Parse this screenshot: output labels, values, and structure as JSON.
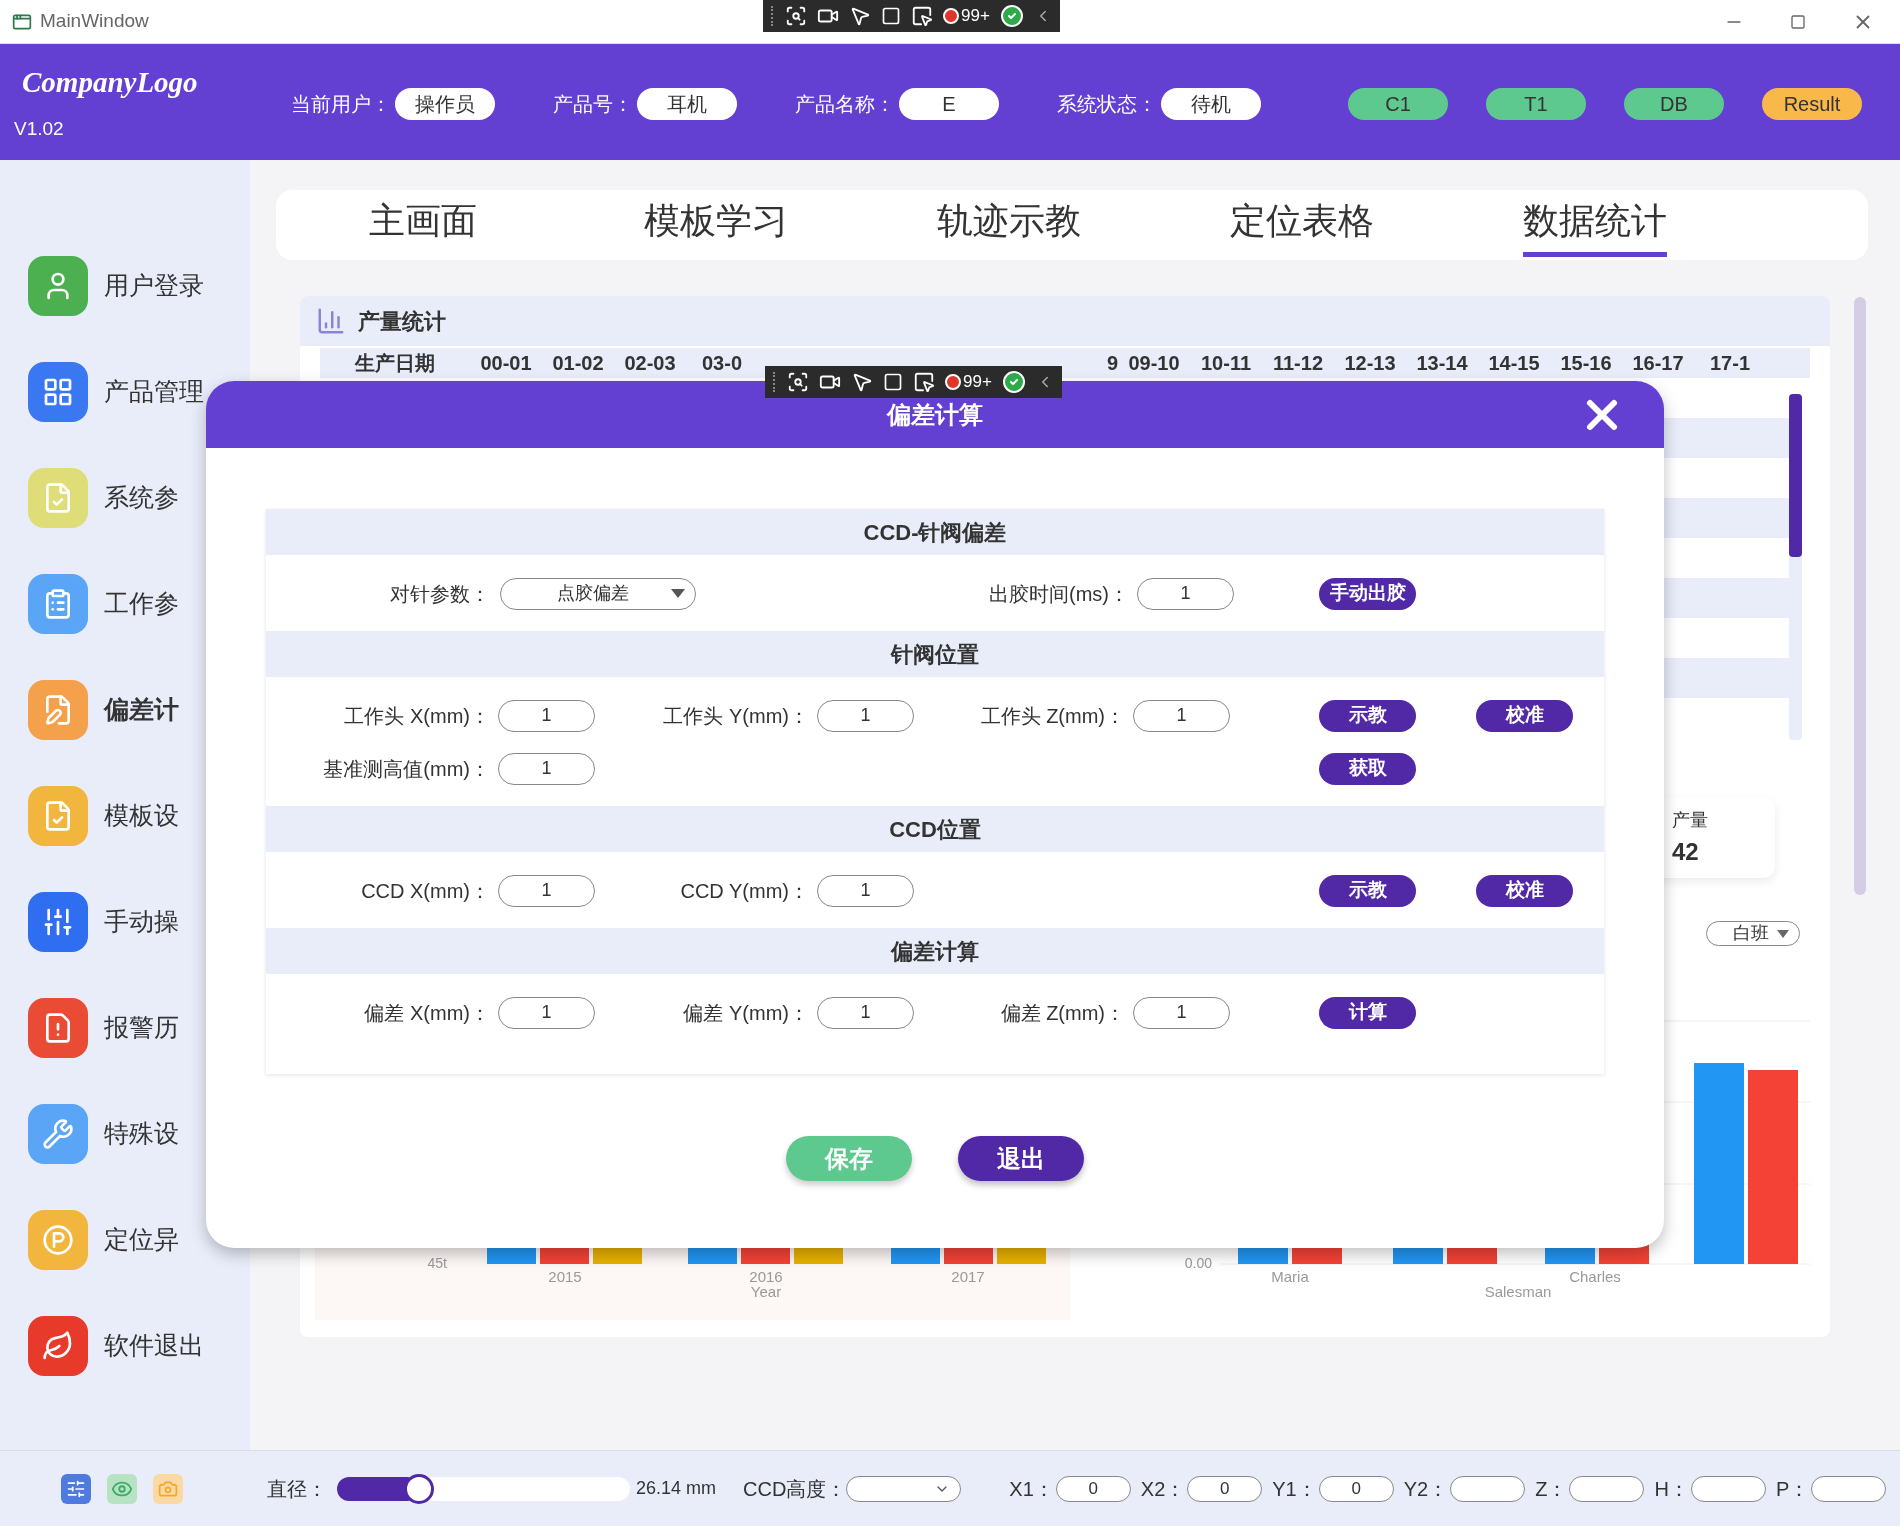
{
  "window": {
    "title": "MainWindow"
  },
  "recorder_toolbars": [
    {
      "badge": "99+"
    },
    {
      "badge": "99+"
    }
  ],
  "header": {
    "logo": "CompanyLogo",
    "version": "V1.02",
    "fields": [
      {
        "label": "当前用户：",
        "value": "操作员"
      },
      {
        "label": "产品号：",
        "value": "耳机"
      },
      {
        "label": "产品名称：",
        "value": "E"
      },
      {
        "label": "系统状态：",
        "value": "待机"
      }
    ],
    "indicators": [
      {
        "label": "C1",
        "color": "#5ec98f"
      },
      {
        "label": "T1",
        "color": "#5ec98f"
      },
      {
        "label": "DB",
        "color": "#5ec98f"
      },
      {
        "label": "Result",
        "color": "#f9b94a"
      }
    ]
  },
  "sidebar": {
    "items": [
      {
        "label": "用户登录",
        "color": "#4cb050",
        "selected": false
      },
      {
        "label": "产品管理",
        "color": "#3a78f2",
        "selected": false
      },
      {
        "label": "系统参",
        "color": "#dedd78",
        "selected": false
      },
      {
        "label": "工作参",
        "color": "#5aa5f5",
        "selected": false
      },
      {
        "label": "偏差计",
        "color": "#f5a04a",
        "selected": true
      },
      {
        "label": "模板设",
        "color": "#f2b53e",
        "selected": false
      },
      {
        "label": "手动操",
        "color": "#2f6ef0",
        "selected": false
      },
      {
        "label": "报警历",
        "color": "#e94b35",
        "selected": false
      },
      {
        "label": "特殊设",
        "color": "#5aa5f5",
        "selected": false
      },
      {
        "label": "定位异",
        "color": "#f2b53e",
        "selected": false
      },
      {
        "label": "软件退出",
        "color": "#e83a2a",
        "selected": false
      }
    ]
  },
  "tabs": [
    {
      "label": "主画面",
      "selected": false
    },
    {
      "label": "模板学习",
      "selected": false
    },
    {
      "label": "轨迹示教",
      "selected": false
    },
    {
      "label": "定位表格",
      "selected": false
    },
    {
      "label": "数据统计",
      "selected": true
    }
  ],
  "stats_panel": {
    "title": "产量统计",
    "table": {
      "columns": [
        "生产日期",
        "00-01",
        "01-02",
        "02-03",
        "03-0",
        "9",
        "09-10",
        "10-11",
        "11-12",
        "12-13",
        "13-14",
        "14-15",
        "15-16",
        "16-17",
        "17-1"
      ]
    },
    "total_card": {
      "label": "产量",
      "value": "42"
    },
    "shift_select": {
      "value": "白班"
    },
    "year_chart": {
      "ytick": "45t",
      "categories": [
        "2015",
        "2016",
        "2017"
      ],
      "xlabel": "Year"
    },
    "salesman_chart": {
      "ytick": "0.00",
      "categories": [
        "Maria",
        "Charles"
      ],
      "xlabel": "Salesman"
    }
  },
  "dialog": {
    "title": "偏差计算",
    "sections": [
      {
        "title": "CCD-针阀偏差",
        "rows": [
          {
            "fields": [
              {
                "kind": "select",
                "label": "对针参数：",
                "value": "点胶偏差"
              },
              {
                "kind": "field",
                "label": "出胶时间(ms)：",
                "value": "1"
              }
            ],
            "buttons": [
              "手动出胶"
            ]
          }
        ]
      },
      {
        "title": "针阀位置",
        "rows": [
          {
            "fields": [
              {
                "kind": "field",
                "label": "工作头 X(mm)：",
                "value": "1"
              },
              {
                "kind": "field",
                "label": "工作头 Y(mm)：",
                "value": "1"
              },
              {
                "kind": "field",
                "label": "工作头 Z(mm)：",
                "value": "1"
              }
            ],
            "buttons": [
              "示教",
              "校准"
            ]
          },
          {
            "fields": [
              {
                "kind": "field",
                "label": "基准测高值(mm)：",
                "value": "1"
              }
            ],
            "buttons": [
              "获取"
            ]
          }
        ]
      },
      {
        "title": "CCD位置",
        "rows": [
          {
            "fields": [
              {
                "kind": "field",
                "label": "CCD X(mm)：",
                "value": "1"
              },
              {
                "kind": "field",
                "label": "CCD Y(mm)：",
                "value": "1"
              }
            ],
            "buttons": [
              "示教",
              "校准"
            ]
          }
        ]
      },
      {
        "title": "偏差计算",
        "rows": [
          {
            "fields": [
              {
                "kind": "field",
                "label": "偏差 X(mm)：",
                "value": "1"
              },
              {
                "kind": "field",
                "label": "偏差 Y(mm)：",
                "value": "1"
              },
              {
                "kind": "field",
                "label": "偏差 Z(mm)：",
                "value": "1"
              }
            ],
            "buttons": [
              "计算"
            ]
          }
        ]
      }
    ],
    "actions": [
      {
        "label": "保存",
        "kind": "confirm"
      },
      {
        "label": "退出",
        "kind": "cancel"
      }
    ]
  },
  "bottom_bar": {
    "diameter": {
      "label": "直径：",
      "level": 0.28,
      "reading": "26.14 mm"
    },
    "ccd_height": {
      "label": "CCD高度："
    },
    "coords": [
      {
        "label": "X1：",
        "value": "0"
      },
      {
        "label": "X2：",
        "value": "0"
      },
      {
        "label": "Y1：",
        "value": "0"
      },
      {
        "label": "Y2："
      },
      {
        "label": "Z："
      },
      {
        "label": "H："
      },
      {
        "label": "P："
      }
    ]
  }
}
